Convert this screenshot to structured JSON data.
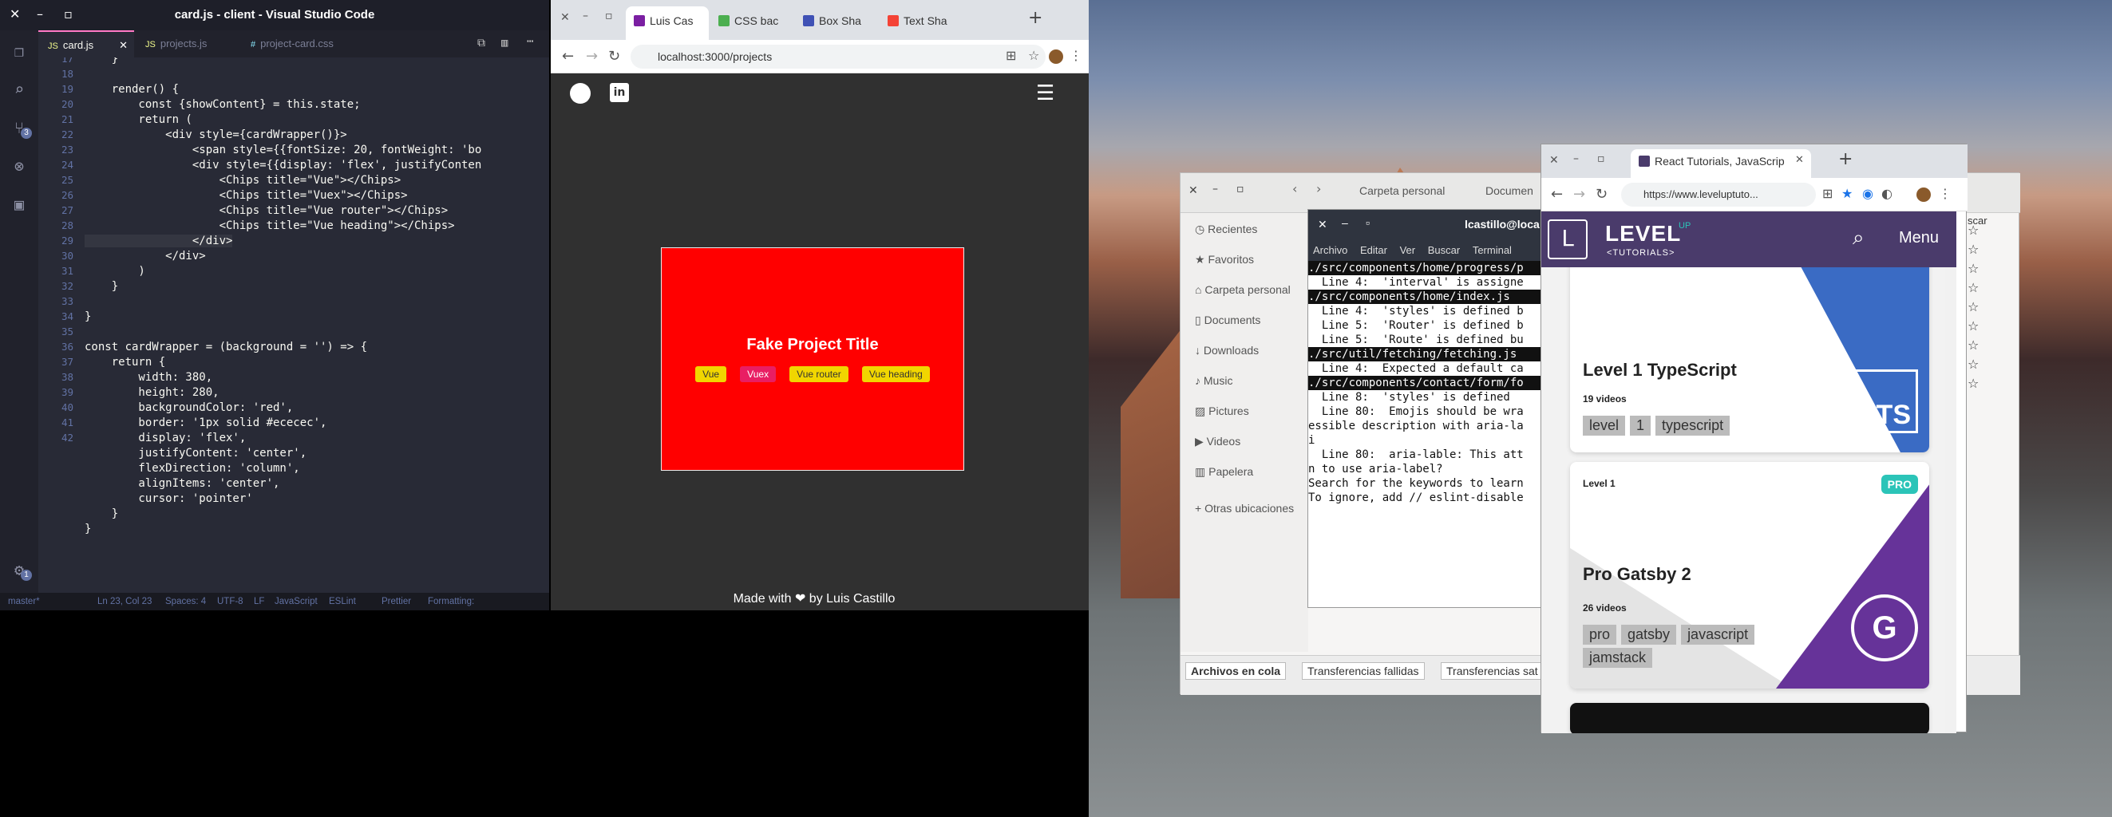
{
  "vscode": {
    "title": "card.js - client - Visual Studio Code",
    "tabs": [
      {
        "label": "card.js",
        "prefix": "JS"
      },
      {
        "label": "projects.js",
        "prefix": "JS"
      },
      {
        "label": "project-card.css",
        "prefix": "#"
      }
    ],
    "scm_badge": "3",
    "gear_badge": "1",
    "line_numbers": [
      "17",
      "18",
      "19",
      "20",
      "21",
      "22",
      "23",
      "24",
      "25",
      "26",
      "27",
      "28",
      "29",
      "30",
      "31",
      "32",
      "33",
      "34",
      "35",
      "36",
      "37",
      "38",
      "39",
      "40",
      "41",
      "42"
    ],
    "code_lines": [
      "    }",
      "",
      "    render() {",
      "        const {showContent} = this.state;",
      "        return (",
      "            <div style={cardWrapper()}>",
      "                <span style={{fontSize: 20, fontWeight: 'bo",
      "                <div style={{display: 'flex', justifyConten",
      "                    <Chips title=\"Vue\"></Chips>",
      "                    <Chips title=\"Vuex\"></Chips>",
      "                    <Chips title=\"Vue router\"></Chips>",
      "                    <Chips title=\"Vue heading\"></Chips>",
      "                </div>",
      "            </div>",
      "        )",
      "    }",
      "",
      "}",
      "",
      "const cardWrapper = (background = '') => {",
      "    return {",
      "        width: 380,",
      "        height: 280,",
      "        backgroundColor: 'red',",
      "        border: '1px solid #ececec',",
      "        display: 'flex',",
      "        justifyContent: 'center',",
      "        flexDirection: 'column',",
      "        alignItems: 'center',",
      "        cursor: 'pointer'",
      "    }",
      "}"
    ],
    "status": {
      "branch": "master*",
      "position": "Ln 23, Col 23",
      "spaces": "Spaces: 4",
      "encoding": "UTF-8",
      "eol": "LF",
      "language": "JavaScript",
      "eslint": "ESLint",
      "prettier": "Prettier",
      "formatting": "Formatting:"
    }
  },
  "chrome_left": {
    "tabs": [
      {
        "label": "Luis Cas",
        "color": "#7b1fa2"
      },
      {
        "label": "CSS bac",
        "color": "#4caf50"
      },
      {
        "label": "Box Sha",
        "color": "#3f51b5"
      },
      {
        "label": "Text Sha",
        "color": "#f44336"
      }
    ],
    "url": "localhost:3000/projects",
    "card_title": "Fake Project Title",
    "chips": [
      "Vue",
      "Vuex",
      "Vue router",
      "Vue heading"
    ],
    "footer": "Made with ❤ by Luis Castillo"
  },
  "files": {
    "path": [
      "Carpeta personal",
      "Documen"
    ],
    "sidebar": [
      "Recientes",
      "Favoritos",
      "Carpeta personal",
      "Documents",
      "Downloads",
      "Music",
      "Pictures",
      "Videos",
      "Papelera",
      "Otras ubicaciones"
    ],
    "bottom_tabs": [
      "Archivos en cola",
      "Transferencias fallidas",
      "Transferencias sat"
    ],
    "right_partial": "scar"
  },
  "terminal": {
    "title": "lcastillo@loca",
    "menu": [
      "Archivo",
      "Editar",
      "Ver",
      "Buscar",
      "Terminal"
    ],
    "lines": [
      {
        "text": "./src/components/home/progress/p",
        "hl": true
      },
      {
        "text": "  Line 4:  'interval' is assigne",
        "hl": false
      },
      {
        "text": "",
        "hl": false
      },
      {
        "text": "./src/components/home/index.js",
        "hl": true
      },
      {
        "text": "  Line 4:  'styles' is defined b",
        "hl": false
      },
      {
        "text": "  Line 5:  'Router' is defined b",
        "hl": false
      },
      {
        "text": "  Line 5:  'Route' is defined bu",
        "hl": false
      },
      {
        "text": "",
        "hl": false
      },
      {
        "text": "./src/util/fetching/fetching.js",
        "hl": true
      },
      {
        "text": "  Line 4:  Expected a default ca",
        "hl": false
      },
      {
        "text": "",
        "hl": false
      },
      {
        "text": "./src/components/contact/form/fo",
        "hl": true
      },
      {
        "text": "  Line 8:  'styles' is defined ",
        "hl": false
      },
      {
        "text": "",
        "hl": false
      },
      {
        "text": "  Line 80:  Emojis should be wra",
        "hl": false
      },
      {
        "text": "essible description with aria-la",
        "hl": false
      },
      {
        "text": "i",
        "hl": false
      },
      {
        "text": "  Line 80:  aria-lable: This att",
        "hl": false
      },
      {
        "text": "n to use aria-label?",
        "hl": false
      },
      {
        "text": "",
        "hl": false
      },
      {
        "text": "Search for the keywords to learn",
        "hl": false
      },
      {
        "text": "To ignore, add // eslint-disable",
        "hl": false
      }
    ]
  },
  "chrome_right": {
    "tab": "React Tutorials, JavaScrip",
    "url": "https://www.leveluptuto...",
    "brand_top": "LEVEL",
    "brand_up": "UP",
    "brand_sub": "<TUTORIALS>",
    "menu": "Menu",
    "cards": [
      {
        "level": "",
        "title": "Level 1 TypeScript",
        "videos": "19 videos",
        "tags": [
          "level",
          "1",
          "typescript"
        ],
        "badge": "TS",
        "pro": false
      },
      {
        "level": "Level 1",
        "title": "Pro Gatsby 2",
        "videos": "26 videos",
        "tags": [
          "pro",
          "gatsby",
          "javascript",
          "jamstack"
        ],
        "badge": "G",
        "pro": true,
        "pro_label": "PRO"
      }
    ]
  }
}
